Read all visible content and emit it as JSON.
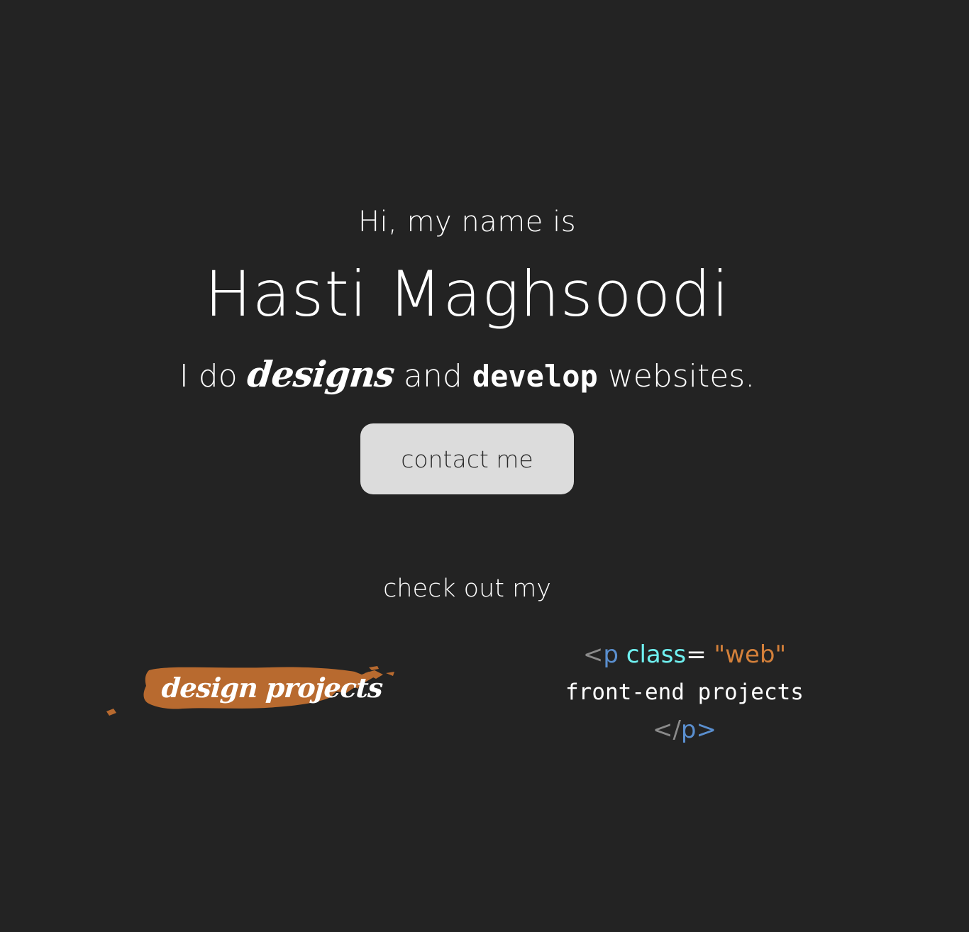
{
  "hero": {
    "greeting": "Hi, my name is",
    "name": "Hasti Maghsoodi",
    "tagline": {
      "prefix": "I do",
      "designs": "designs",
      "and": "and",
      "develop": "develop",
      "suffix": "websites."
    },
    "contact_button": "contact me"
  },
  "projects": {
    "intro": "check out my",
    "design_link": "design projects",
    "web_link": {
      "open_bracket": "<",
      "tag": "p",
      "attr": "class",
      "equals": "=",
      "value": "\"web\"",
      "text": "front-end projects",
      "close_bracket_open": "</",
      "close_tag": "p",
      "close_bracket_end": ">"
    }
  },
  "colors": {
    "background": "#232323",
    "brush_orange": "#b86a2f",
    "button_bg": "#dcdcdc",
    "code_blue": "#5a8fcf",
    "code_cyan": "#6ff0f0",
    "code_orange": "#d4803a"
  }
}
